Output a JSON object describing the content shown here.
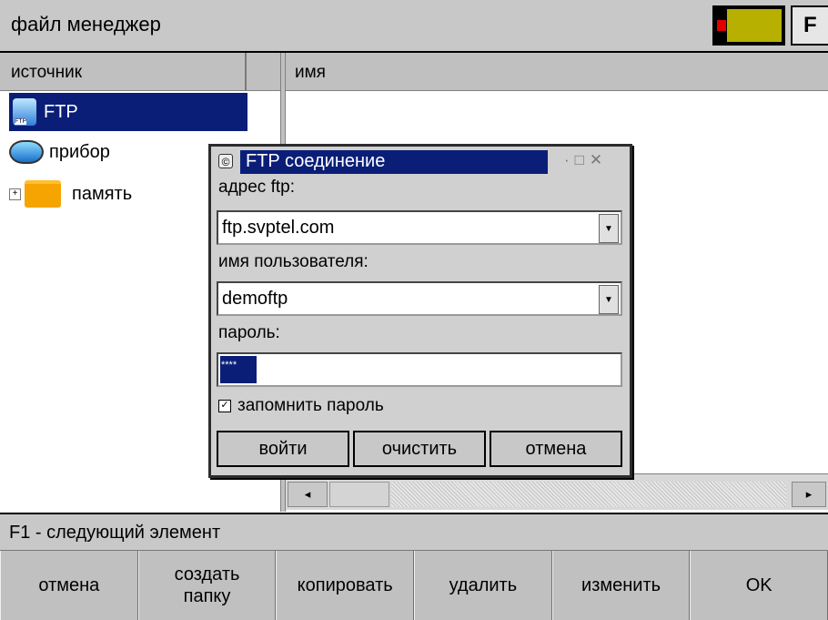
{
  "titlebar": {
    "title": "файл менеджер",
    "f_key": "F",
    "battery_colors": [
      "#e00000",
      "#b7b000"
    ]
  },
  "source_panel": {
    "header": "источник",
    "items": [
      {
        "label": "FTP",
        "icon": "ftp-icon",
        "selected": true
      },
      {
        "label": "прибор",
        "icon": "monitor-icon",
        "selected": false
      },
      {
        "label": "память",
        "icon": "folder-icon",
        "expandable": true,
        "selected": false
      }
    ]
  },
  "file_panel": {
    "header": "имя"
  },
  "dialog": {
    "title": "FTP соединение",
    "ftp_address_label": "адрес ftp:",
    "ftp_address_value": "ftp.svptel.com",
    "username_label": "имя пользователя:",
    "username_value": "demoftp",
    "password_label": "пароль:",
    "password_value": "****",
    "remember_label": "запомнить пароль",
    "remember_checked": true,
    "buttons": {
      "login": "войти",
      "clear": "очистить",
      "cancel": "отмена"
    }
  },
  "status": {
    "text": "F1 - следующий элемент"
  },
  "bottom_buttons": [
    {
      "label": "отмена"
    },
    {
      "label": "создать\nпапку"
    },
    {
      "label": "копировать"
    },
    {
      "label": "удалить"
    },
    {
      "label": "изменить"
    },
    {
      "label": "OK"
    }
  ],
  "colors": {
    "selection": "#0a1e78",
    "chrome": "#c8c8c8"
  }
}
